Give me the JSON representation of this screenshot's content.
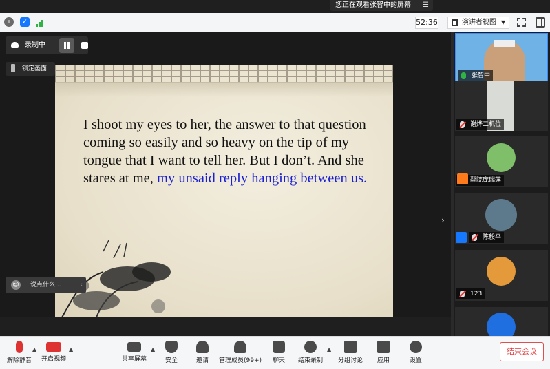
{
  "banner": {
    "text": "您正在观看张智中的屏幕"
  },
  "topbar": {
    "timer": "52:36",
    "view_label": "演讲者视图"
  },
  "recording": {
    "label": "录制中"
  },
  "lock": {
    "label": "锁定画面"
  },
  "chat": {
    "placeholder": "说点什么..."
  },
  "slide": {
    "text_main": "I shoot my eyes to her, the answer to that question coming so easily and so heavy on the tip of my tongue that I want to tell her. But I don’t. And she stares at me, ",
    "text_highlight": "my unsaid reply hanging between us."
  },
  "participants": [
    {
      "name": "张智中",
      "mic": "on"
    },
    {
      "name": "谢烨二机位",
      "mic": "muted"
    },
    {
      "name": "翻院庞瑞莲",
      "mic": "muted"
    },
    {
      "name": "陈毅平",
      "mic": "muted"
    },
    {
      "name": "123",
      "mic": "muted"
    },
    {
      "name": ""
    }
  ],
  "bottombar": {
    "mute": "解除静音",
    "video": "开启视频",
    "share": "共享屏幕",
    "security": "安全",
    "invite": "邀请",
    "members": "管理成员(99+)",
    "chat": "聊天",
    "stop_record": "结束录制",
    "breakout": "分组讨论",
    "apps": "应用",
    "settings": "设置",
    "end": "结束会议"
  },
  "colors": {
    "accent": "#1677ff",
    "highlight_text": "#1a1fd1",
    "end_red": "#e03a3a"
  }
}
